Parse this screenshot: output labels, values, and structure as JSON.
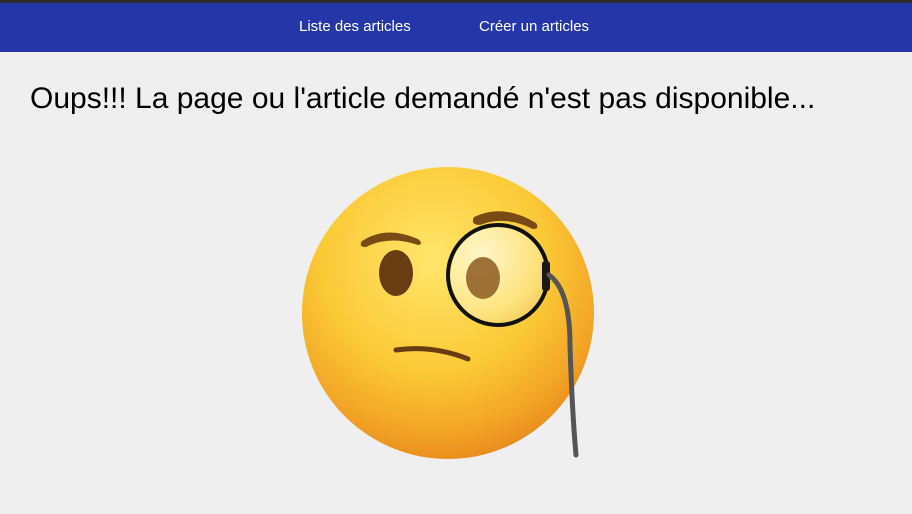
{
  "nav": {
    "items": [
      {
        "label": "Liste des articles"
      },
      {
        "label": "Créer un articles"
      }
    ],
    "background": "#2537a8"
  },
  "main": {
    "title": "Oups!!! La page ou l'article demandé n'est pas disponible...",
    "illustration": "face-with-monocle-emoji"
  },
  "colors": {
    "page_background": "#efefef",
    "nav_background": "#2537a8",
    "nav_text": "#ffffff",
    "emoji_face": "#fbc02d"
  }
}
